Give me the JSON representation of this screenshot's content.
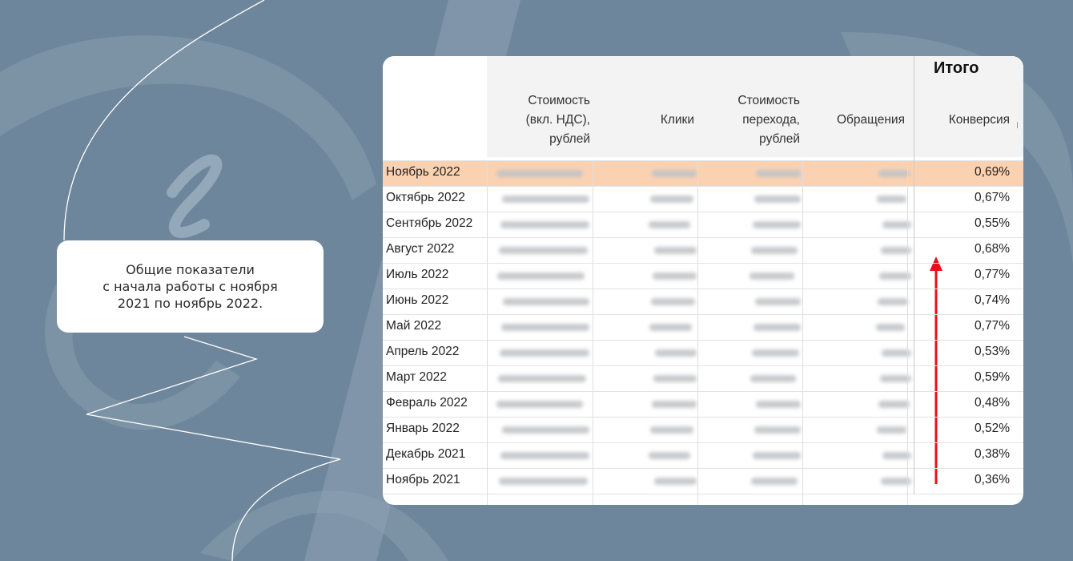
{
  "callout": {
    "text": "Общие показатели\nс начала работы с ноября\n2021 по ноябрь 2022."
  },
  "table": {
    "group_title": "Итого",
    "columns": [
      "Стоимость\n(вкл. НДС),\nрублей",
      "Клики",
      "Стоимость\nперехода,\nрублей",
      "Обращения",
      "Конверсия"
    ],
    "rows": [
      {
        "month": "Ноябрь 2022",
        "conversion": "0,69%",
        "highlight": true
      },
      {
        "month": "Октябрь 2022",
        "conversion": "0,67%"
      },
      {
        "month": "Сентябрь 2022",
        "conversion": "0,55%"
      },
      {
        "month": "Август 2022",
        "conversion": "0,68%"
      },
      {
        "month": "Июль 2022",
        "conversion": "0,77%"
      },
      {
        "month": "Июнь 2022",
        "conversion": "0,74%"
      },
      {
        "month": "Май 2022",
        "conversion": "0,77%"
      },
      {
        "month": "Апрель 2022",
        "conversion": "0,53%"
      },
      {
        "month": "Март 2022",
        "conversion": "0,59%"
      },
      {
        "month": "Февраль 2022",
        "conversion": "0,48%"
      },
      {
        "month": "Январь 2022",
        "conversion": "0,52%"
      },
      {
        "month": "Декабрь 2021",
        "conversion": "0,38%"
      },
      {
        "month": "Ноябрь 2021",
        "conversion": "0,36%"
      }
    ]
  },
  "colors": {
    "background": "#6e869b",
    "highlight_row": "#fbd2b1",
    "arrow": "#e8101b"
  },
  "icons": [
    "up-arrow-icon"
  ]
}
